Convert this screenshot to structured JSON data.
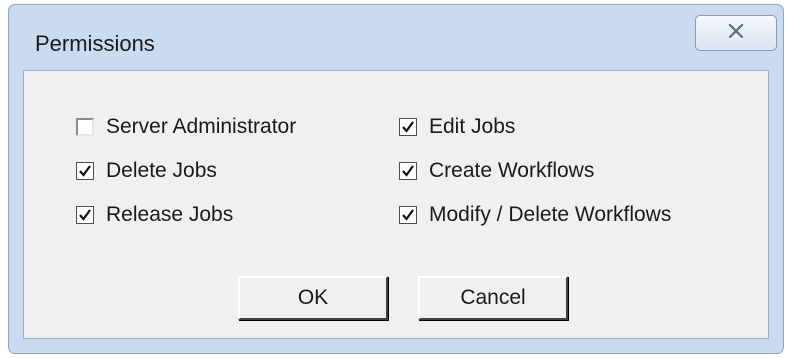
{
  "window": {
    "title": "Permissions",
    "close_icon": "close-icon"
  },
  "permissions": [
    {
      "label": "Server Administrator",
      "checked": false
    },
    {
      "label": "Delete Jobs",
      "checked": true
    },
    {
      "label": "Release Jobs",
      "checked": true
    },
    {
      "label": "Edit Jobs",
      "checked": true
    },
    {
      "label": "Create Workflows",
      "checked": true
    },
    {
      "label": "Modify / Delete Workflows",
      "checked": true
    }
  ],
  "buttons": {
    "ok_label": "OK",
    "cancel_label": "Cancel"
  }
}
